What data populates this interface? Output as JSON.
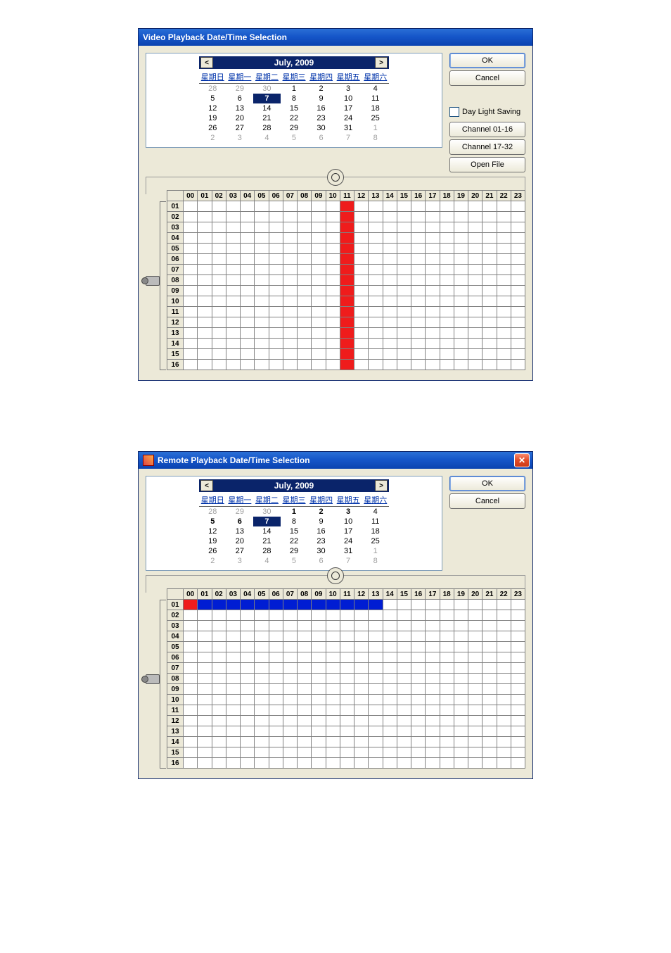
{
  "windows": [
    {
      "title": "Video Playback Date/Time Selection",
      "show_title_icon": false,
      "show_close": false,
      "calendar": {
        "month_label": "July, 2009",
        "dow": [
          "星期日",
          "星期一",
          "星期二",
          "星期三",
          "星期四",
          "星期五",
          "星期六"
        ],
        "days": [
          {
            "n": "28",
            "dim": true
          },
          {
            "n": "29",
            "dim": true
          },
          {
            "n": "30",
            "dim": true
          },
          {
            "n": "1"
          },
          {
            "n": "2"
          },
          {
            "n": "3"
          },
          {
            "n": "4"
          },
          {
            "n": "5"
          },
          {
            "n": "6"
          },
          {
            "n": "7",
            "sel": true
          },
          {
            "n": "8"
          },
          {
            "n": "9"
          },
          {
            "n": "10"
          },
          {
            "n": "11"
          },
          {
            "n": "12"
          },
          {
            "n": "13"
          },
          {
            "n": "14"
          },
          {
            "n": "15"
          },
          {
            "n": "16"
          },
          {
            "n": "17"
          },
          {
            "n": "18"
          },
          {
            "n": "19"
          },
          {
            "n": "20"
          },
          {
            "n": "21"
          },
          {
            "n": "22"
          },
          {
            "n": "23"
          },
          {
            "n": "24"
          },
          {
            "n": "25"
          },
          {
            "n": "26"
          },
          {
            "n": "27"
          },
          {
            "n": "28"
          },
          {
            "n": "29"
          },
          {
            "n": "30"
          },
          {
            "n": "31"
          },
          {
            "n": "1",
            "dim": true
          },
          {
            "n": "2",
            "dim": true
          },
          {
            "n": "3",
            "dim": true
          },
          {
            "n": "4",
            "dim": true
          },
          {
            "n": "5",
            "dim": true
          },
          {
            "n": "6",
            "dim": true
          },
          {
            "n": "7",
            "dim": true
          },
          {
            "n": "8",
            "dim": true
          }
        ]
      },
      "buttons": {
        "ok": "OK",
        "cancel": "Cancel",
        "dls": "Day Light Saving",
        "ch1": "Channel 01-16",
        "ch2": "Channel 17-32",
        "open": "Open File"
      },
      "show_extra_buttons": true,
      "hours": [
        "00",
        "01",
        "02",
        "03",
        "04",
        "05",
        "06",
        "07",
        "08",
        "09",
        "10",
        "11",
        "12",
        "13",
        "14",
        "15",
        "16",
        "17",
        "18",
        "19",
        "20",
        "21",
        "22",
        "23"
      ],
      "channels": [
        "01",
        "02",
        "03",
        "04",
        "05",
        "06",
        "07",
        "08",
        "09",
        "10",
        "11",
        "12",
        "13",
        "14",
        "15",
        "16"
      ],
      "marks": {
        "type": "column",
        "color": "red",
        "hour": "11",
        "channels": [
          "01",
          "02",
          "03",
          "04",
          "05",
          "06",
          "07",
          "08",
          "09",
          "10",
          "11",
          "12",
          "13",
          "14",
          "15",
          "16"
        ]
      }
    },
    {
      "title": "Remote Playback Date/Time Selection",
      "show_title_icon": true,
      "show_close": true,
      "calendar": {
        "month_label": "July, 2009",
        "dow": [
          "星期日",
          "星期一",
          "星期二",
          "星期三",
          "星期四",
          "星期五",
          "星期六"
        ],
        "days": [
          {
            "n": "28",
            "dim": true
          },
          {
            "n": "29",
            "dim": true
          },
          {
            "n": "30",
            "dim": true
          },
          {
            "n": "1",
            "bold": true
          },
          {
            "n": "2",
            "bold": true
          },
          {
            "n": "3",
            "bold": true
          },
          {
            "n": "4"
          },
          {
            "n": "5",
            "bold": true
          },
          {
            "n": "6",
            "bold": true
          },
          {
            "n": "7",
            "sel": true,
            "bold": true
          },
          {
            "n": "8"
          },
          {
            "n": "9"
          },
          {
            "n": "10"
          },
          {
            "n": "11"
          },
          {
            "n": "12"
          },
          {
            "n": "13"
          },
          {
            "n": "14"
          },
          {
            "n": "15"
          },
          {
            "n": "16"
          },
          {
            "n": "17"
          },
          {
            "n": "18"
          },
          {
            "n": "19"
          },
          {
            "n": "20"
          },
          {
            "n": "21"
          },
          {
            "n": "22"
          },
          {
            "n": "23"
          },
          {
            "n": "24"
          },
          {
            "n": "25"
          },
          {
            "n": "26"
          },
          {
            "n": "27"
          },
          {
            "n": "28"
          },
          {
            "n": "29"
          },
          {
            "n": "30"
          },
          {
            "n": "31"
          },
          {
            "n": "1",
            "dim": true
          },
          {
            "n": "2",
            "dim": true
          },
          {
            "n": "3",
            "dim": true
          },
          {
            "n": "4",
            "dim": true
          },
          {
            "n": "5",
            "dim": true
          },
          {
            "n": "6",
            "dim": true
          },
          {
            "n": "7",
            "dim": true
          },
          {
            "n": "8",
            "dim": true
          }
        ]
      },
      "buttons": {
        "ok": "OK",
        "cancel": "Cancel"
      },
      "show_extra_buttons": false,
      "hours": [
        "00",
        "01",
        "02",
        "03",
        "04",
        "05",
        "06",
        "07",
        "08",
        "09",
        "10",
        "11",
        "12",
        "13",
        "14",
        "15",
        "16",
        "17",
        "18",
        "19",
        "20",
        "21",
        "22",
        "23"
      ],
      "channels": [
        "01",
        "02",
        "03",
        "04",
        "05",
        "06",
        "07",
        "08",
        "09",
        "10",
        "11",
        "12",
        "13",
        "14",
        "15",
        "16"
      ],
      "marks": {
        "type": "row",
        "channel": "01",
        "cells": [
          {
            "hour": "00",
            "color": "red"
          },
          {
            "hour": "01",
            "color": "blue"
          },
          {
            "hour": "02",
            "color": "blue"
          },
          {
            "hour": "03",
            "color": "blue"
          },
          {
            "hour": "04",
            "color": "blue"
          },
          {
            "hour": "05",
            "color": "blue"
          },
          {
            "hour": "06",
            "color": "blue"
          },
          {
            "hour": "07",
            "color": "blue"
          },
          {
            "hour": "08",
            "color": "blue"
          },
          {
            "hour": "09",
            "color": "blue"
          },
          {
            "hour": "10",
            "color": "blue"
          },
          {
            "hour": "11",
            "color": "blue"
          },
          {
            "hour": "12",
            "color": "blue"
          },
          {
            "hour": "13",
            "color": "blue"
          }
        ]
      }
    }
  ]
}
